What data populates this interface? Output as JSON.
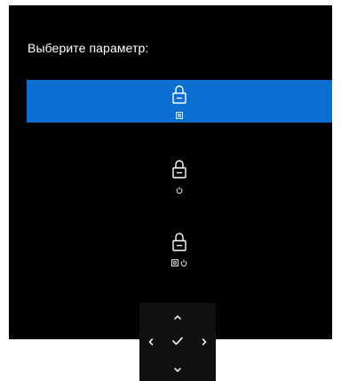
{
  "osd": {
    "prompt": "Выберите параметр:",
    "options": [
      {
        "icon": "lock-icon",
        "sub_icons": [
          "menu-icon"
        ],
        "selected": true
      },
      {
        "icon": "lock-icon",
        "sub_icons": [
          "power-icon"
        ],
        "selected": false
      },
      {
        "icon": "lock-icon",
        "sub_icons": [
          "menu-icon",
          "power-icon"
        ],
        "selected": false
      }
    ],
    "colors": {
      "panel_background": "#000000",
      "selection": "#0a6fd1",
      "foreground": "#ffffff",
      "nav_pad_background": "#101010"
    }
  },
  "navigation": {
    "buttons": [
      "chevron-up-icon",
      "chevron-left-icon",
      "checkmark-icon",
      "chevron-right-icon",
      "chevron-down-icon"
    ]
  }
}
